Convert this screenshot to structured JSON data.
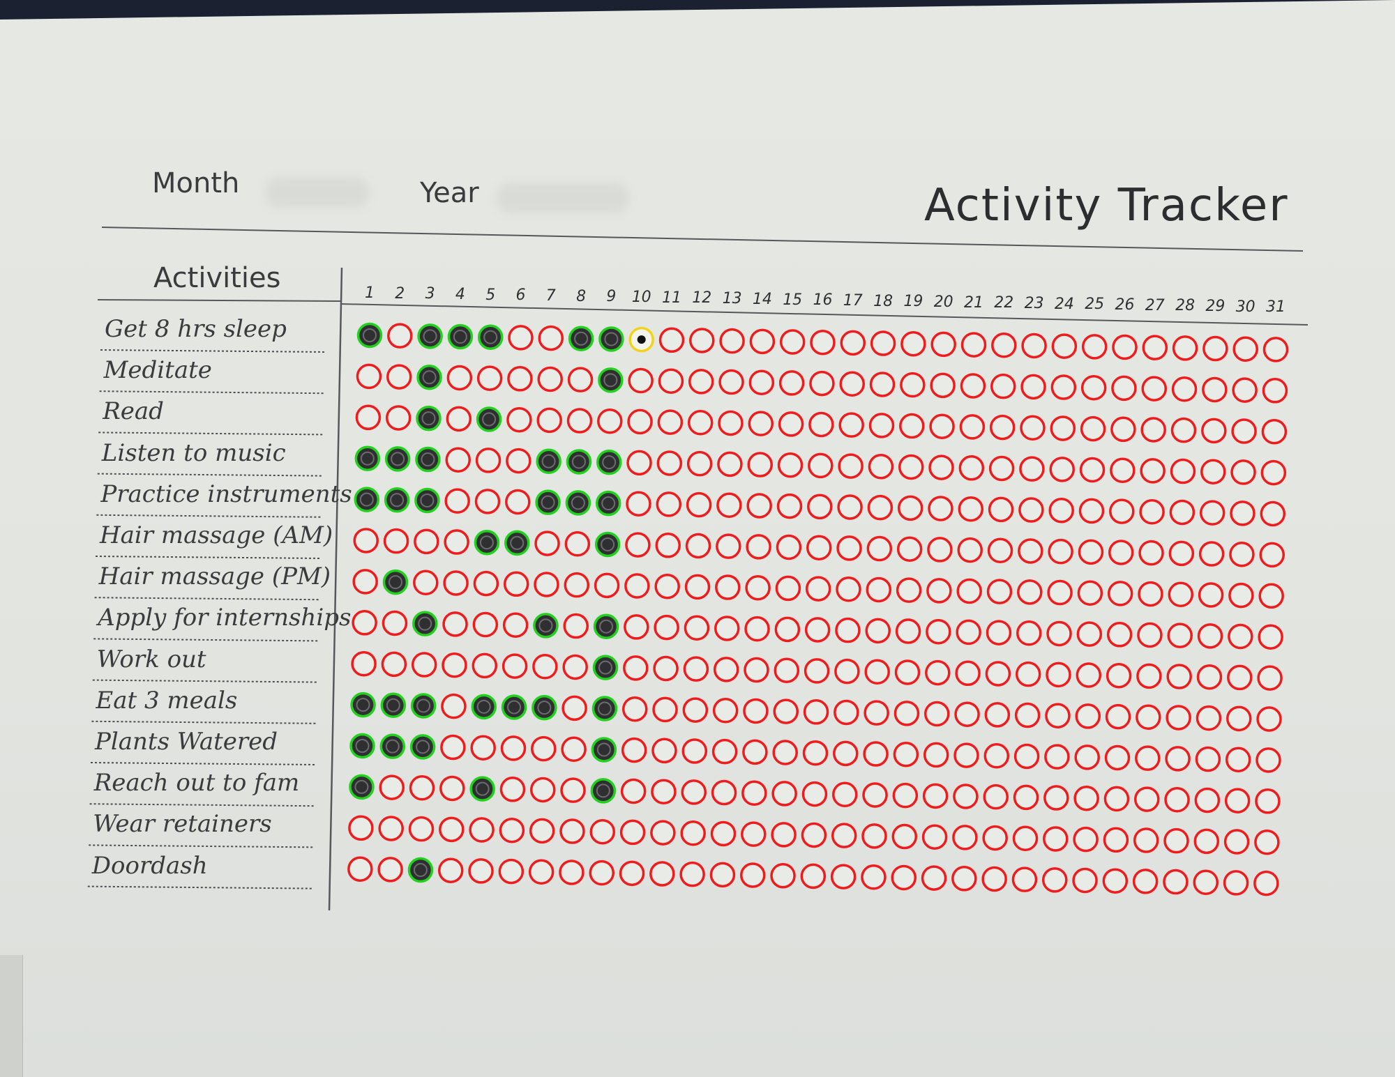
{
  "header": {
    "month_label": "Month",
    "year_label": "Year",
    "title": "Activity Tracker"
  },
  "table": {
    "activities_label": "Activities",
    "days": [
      "1",
      "2",
      "3",
      "4",
      "5",
      "6",
      "7",
      "8",
      "9",
      "10",
      "11",
      "12",
      "13",
      "14",
      "15",
      "16",
      "17",
      "18",
      "19",
      "20",
      "21",
      "22",
      "23",
      "24",
      "25",
      "26",
      "27",
      "28",
      "29",
      "30",
      "31"
    ],
    "rows": [
      {
        "label": "Get 8 hrs sleep",
        "done": [
          1,
          3,
          4,
          5,
          8,
          9
        ],
        "marked": [
          10
        ]
      },
      {
        "label": "Meditate",
        "done": [
          3,
          9
        ],
        "marked": []
      },
      {
        "label": "Read",
        "done": [
          3,
          5
        ],
        "marked": []
      },
      {
        "label": "Listen to music",
        "done": [
          1,
          2,
          3,
          7,
          8,
          9
        ],
        "marked": []
      },
      {
        "label": "Practice instruments",
        "done": [
          1,
          2,
          3,
          7,
          8,
          9
        ],
        "marked": []
      },
      {
        "label": "Hair massage (AM)",
        "done": [
          5,
          6,
          9
        ],
        "marked": []
      },
      {
        "label": "Hair massage (PM)",
        "done": [
          2
        ],
        "marked": []
      },
      {
        "label": "Apply for internships",
        "done": [
          3,
          7,
          9
        ],
        "marked": []
      },
      {
        "label": "Work out",
        "done": [
          9
        ],
        "marked": []
      },
      {
        "label": "Eat 3 meals",
        "done": [
          1,
          2,
          3,
          5,
          6,
          7,
          9
        ],
        "marked": []
      },
      {
        "label": "Plants Watered",
        "done": [
          1,
          2,
          3,
          9
        ],
        "marked": []
      },
      {
        "label": "Reach out to fam",
        "done": [
          1,
          5,
          9
        ],
        "marked": []
      },
      {
        "label": "Wear retainers",
        "done": [],
        "marked": []
      },
      {
        "label": "Doordash",
        "done": [
          3
        ],
        "marked": []
      }
    ]
  },
  "colors": {
    "empty_ring": "#ee1c1c",
    "done_ring": "#22d11e",
    "done_fill": "#2f2f31",
    "marked_ring": "#f2d21a",
    "ink": "#3a3b3d"
  }
}
